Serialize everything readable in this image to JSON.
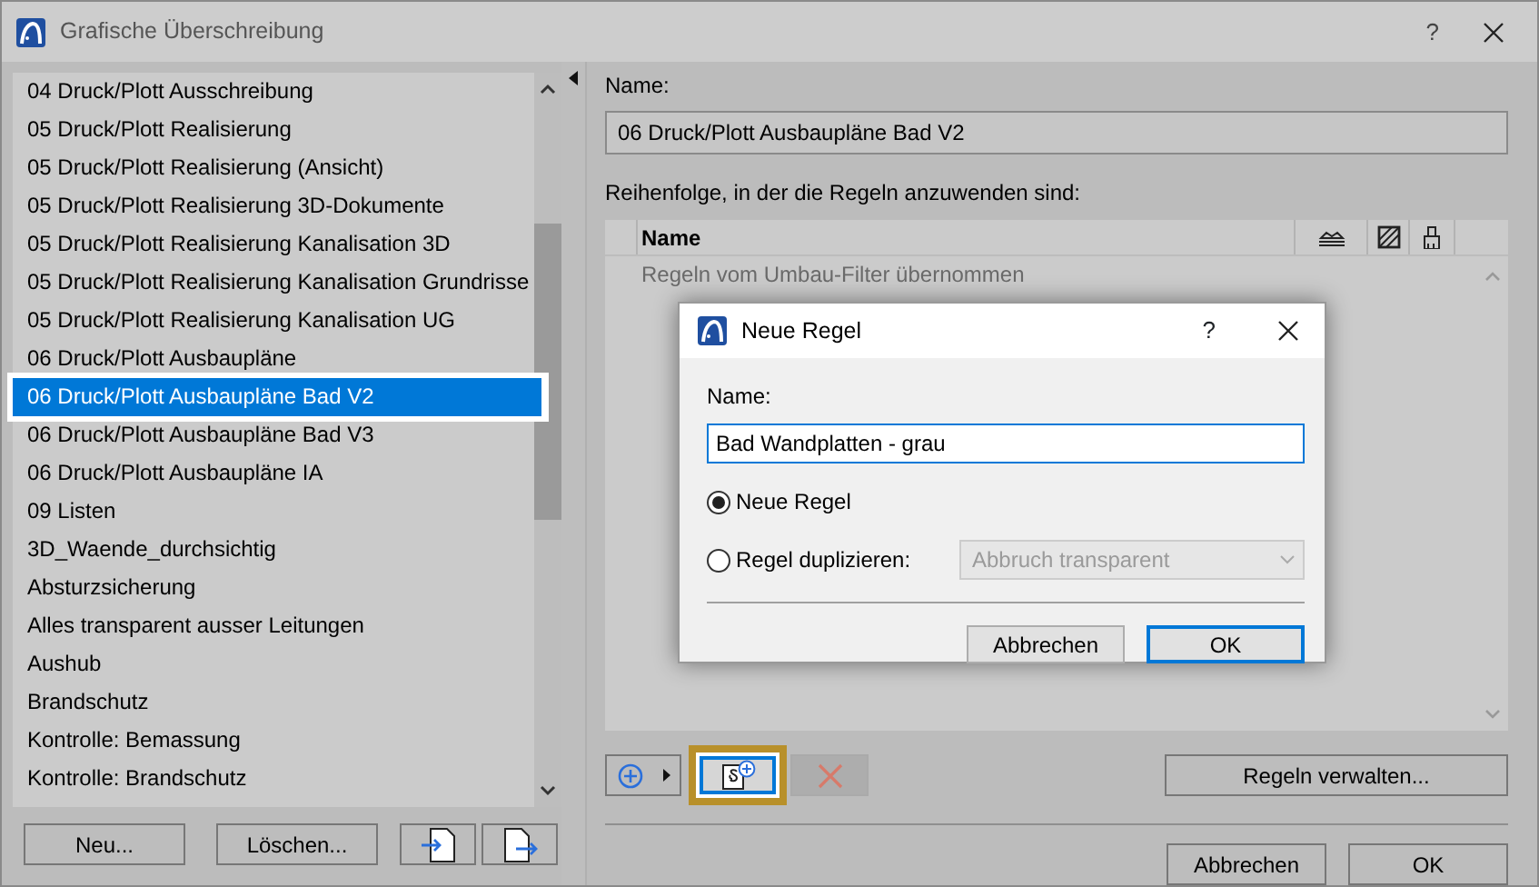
{
  "window": {
    "title": "Grafische Überschreibung",
    "help": "?"
  },
  "combinations": {
    "items": [
      {
        "label": "04 Druck/Plott Ausschreibung",
        "selected": false
      },
      {
        "label": "05 Druck/Plott Realisierung",
        "selected": false
      },
      {
        "label": "05 Druck/Plott Realisierung (Ansicht)",
        "selected": false
      },
      {
        "label": "05 Druck/Plott Realisierung 3D-Dokumente",
        "selected": false
      },
      {
        "label": "05 Druck/Plott Realisierung Kanalisation 3D",
        "selected": false
      },
      {
        "label": "05 Druck/Plott Realisierung Kanalisation Grundrisse",
        "selected": false
      },
      {
        "label": "05 Druck/Plott Realisierung Kanalisation UG",
        "selected": false
      },
      {
        "label": "06 Druck/Plott Ausbaupläne",
        "selected": false
      },
      {
        "label": "06 Druck/Plott Ausbaupläne Bad V2",
        "selected": true
      },
      {
        "label": "06 Druck/Plott Ausbaupläne Bad V3",
        "selected": false
      },
      {
        "label": "06 Druck/Plott Ausbaupläne IA",
        "selected": false
      },
      {
        "label": "09 Listen",
        "selected": false
      },
      {
        "label": "3D_Waende_durchsichtig",
        "selected": false
      },
      {
        "label": "Absturzsicherung",
        "selected": false
      },
      {
        "label": "Alles transparent ausser Leitungen",
        "selected": false
      },
      {
        "label": "Aushub",
        "selected": false
      },
      {
        "label": "Brandschutz",
        "selected": false
      },
      {
        "label": "Kontrolle: Bemassung",
        "selected": false
      },
      {
        "label": "Kontrolle: Brandschutz",
        "selected": false
      }
    ],
    "buttons": [
      "Neu...",
      "Löschen..."
    ]
  },
  "name_label": "Name:",
  "name_value": "06 Druck/Plott Ausbaupläne Bad V2",
  "order_label": "Reihenfolge, in der die Regeln anzuwenden sind:",
  "rules_table": {
    "columns": [
      "Name"
    ],
    "rows": [
      {
        "label": "Regeln vom Umbau-Filter übernommen",
        "kind": "group"
      }
    ]
  },
  "toolbar": {
    "new_rule_highlighted": true,
    "delete_disabled": true,
    "manage": "Regeln verwalten..."
  },
  "footer_buttons": [
    "Abbrechen",
    "OK"
  ],
  "dialog": {
    "title": "Neue Regel",
    "help": "?",
    "name_label": "Name:",
    "name_value": "Bad Wandplatten - grau",
    "options": [
      {
        "label": "Neue Regel",
        "selected": true
      },
      {
        "label": "Regel duplizieren:",
        "selected": false
      }
    ],
    "duplicate_select": {
      "value": "Abbruch transparent",
      "disabled": true
    },
    "buttons": [
      {
        "label": "Abbrechen",
        "default": false
      },
      {
        "label": "OK",
        "default": true
      }
    ]
  }
}
